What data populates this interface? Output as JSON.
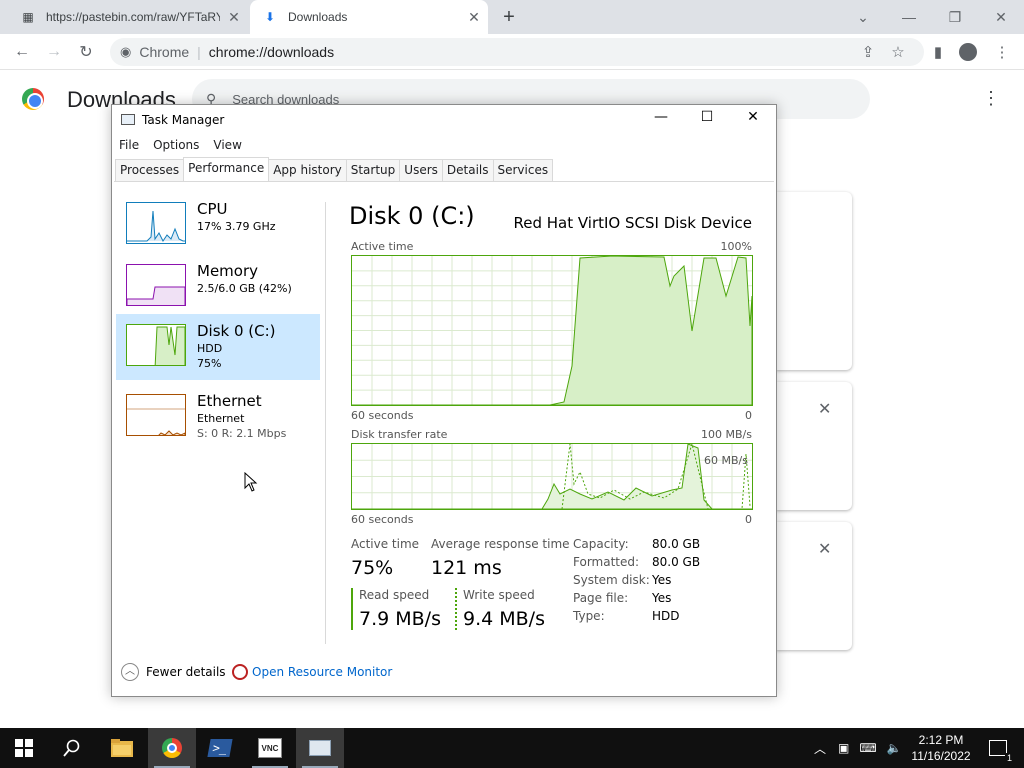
{
  "browser": {
    "tabs": [
      {
        "title": "https://pastebin.com/raw/YFTaRY",
        "active": false
      },
      {
        "title": "Downloads",
        "active": true
      }
    ],
    "address_chip": "Chrome",
    "address_url": "chrome://downloads"
  },
  "downloads_page": {
    "title": "Downloads",
    "search_placeholder": "Search downloads"
  },
  "task_manager": {
    "window_title": "Task Manager",
    "menu": [
      "File",
      "Options",
      "View"
    ],
    "tabs": [
      "Processes",
      "Performance",
      "App history",
      "Startup",
      "Users",
      "Details",
      "Services"
    ],
    "selected_tab": "Performance",
    "resources": [
      {
        "name": "CPU",
        "line1": "17% 3.79 GHz",
        "line2": ""
      },
      {
        "name": "Memory",
        "line1": "2.5/6.0 GB (42%)",
        "line2": ""
      },
      {
        "name": "Disk 0 (C:)",
        "line1": "HDD",
        "line2": "75%"
      },
      {
        "name": "Ethernet",
        "line1": "Ethernet",
        "line2": "S: 0 R: 2.1 Mbps"
      }
    ],
    "selected_resource": "Disk 0 (C:)",
    "pane": {
      "title": "Disk 0 (C:)",
      "device": "Red Hat VirtIO SCSI Disk Device",
      "active_time_label": "Active time",
      "active_time_max": "100%",
      "active_time_left_axis": "60 seconds",
      "active_time_right_axis": "0",
      "transfer_label": "Disk transfer rate",
      "transfer_max": "100 MB/s",
      "transfer_mid": "60 MB/s",
      "transfer_left_axis": "60 seconds",
      "transfer_right_axis": "0",
      "stats": {
        "active_time_label": "Active time",
        "active_time_value": "75%",
        "avg_response_label": "Average response time",
        "avg_response_value": "121 ms",
        "read_label": "Read speed",
        "read_value": "7.9 MB/s",
        "write_label": "Write speed",
        "write_value": "9.4 MB/s"
      },
      "details": [
        {
          "key": "Capacity:",
          "value": "80.0 GB"
        },
        {
          "key": "Formatted:",
          "value": "80.0 GB"
        },
        {
          "key": "System disk:",
          "value": "Yes"
        },
        {
          "key": "Page file:",
          "value": "Yes"
        },
        {
          "key": "Type:",
          "value": "HDD"
        }
      ]
    },
    "footer": {
      "fewer_details": "Fewer details",
      "resource_monitor": "Open Resource Monitor"
    }
  },
  "taskbar": {
    "time": "2:12 PM",
    "date": "11/16/2022",
    "notification_count": "1"
  },
  "colors": {
    "disk_green": "#4da60c",
    "cpu_blue": "#117dbb",
    "memory_purple": "#8b12ae",
    "ethernet_orange": "#a74f01",
    "selection": "#cce8ff"
  }
}
